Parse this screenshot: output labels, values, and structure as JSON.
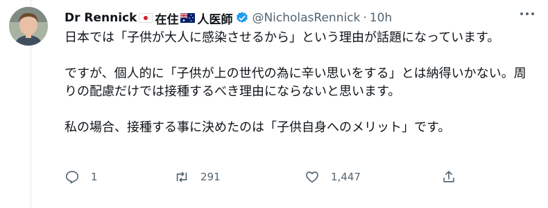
{
  "tweet": {
    "display_name": "Dr Rennick",
    "name_suffix": "在住",
    "name_suffix2": "人医師",
    "handle": "@NicholasRennick",
    "separator": "·",
    "time": "10h",
    "paragraphs": [
      "日本では「子供が大人に感染させるから」という理由が話題になっています。",
      "ですが、個人的に「子供が上の世代の為に辛い思いをする」とは納得いかない。周りの配慮だけでは接種するべき理由にならないと思います。",
      "私の場合、接種する事に決めたのは「子供自身へのメリット」です。"
    ],
    "actions": {
      "reply_count": "1",
      "retweet_count": "291",
      "like_count": "1,447"
    }
  },
  "icons": {
    "verified": "verified-badge-icon",
    "reply": "reply-icon",
    "retweet": "retweet-icon",
    "like": "heart-icon",
    "share": "share-icon",
    "more": "more-icon"
  },
  "colors": {
    "verified": "#1d9bf0",
    "secondary_text": "#536471"
  }
}
